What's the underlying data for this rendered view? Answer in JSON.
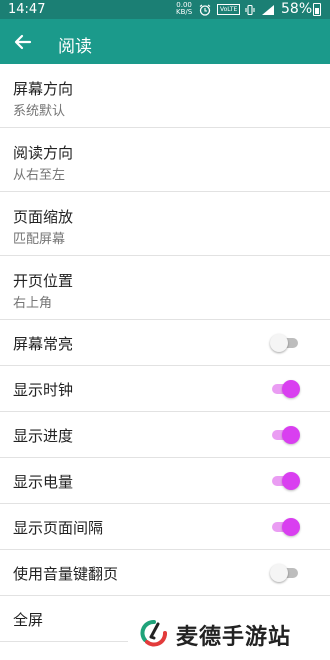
{
  "status_bar": {
    "time": "14:47",
    "speed_value": "0.00",
    "speed_unit": "KB/S",
    "volte": "VoLTE",
    "battery": "58%"
  },
  "app_bar": {
    "title": "阅读",
    "back_icon": "arrow-left-icon"
  },
  "settings": {
    "items": [
      {
        "title": "屏幕方向",
        "subtitle": "系统默认"
      },
      {
        "title": "阅读方向",
        "subtitle": "从右至左"
      },
      {
        "title": "页面缩放",
        "subtitle": "匹配屏幕"
      },
      {
        "title": "开页位置",
        "subtitle": "右上角"
      },
      {
        "title": "屏幕常亮",
        "toggle": false
      },
      {
        "title": "显示时钟",
        "toggle": true
      },
      {
        "title": "显示进度",
        "toggle": true
      },
      {
        "title": "显示电量",
        "toggle": true
      },
      {
        "title": "显示页面间隔",
        "toggle": true
      },
      {
        "title": "使用音量键翻页",
        "toggle": false
      },
      {
        "title": "全屏"
      }
    ]
  },
  "watermark": {
    "text": "麦德手游站"
  },
  "colors": {
    "status_bar": "#1b7f74",
    "app_bar": "#1b9a8b",
    "switch_on": "#d93ff0",
    "switch_off": "#bdbdbd"
  }
}
